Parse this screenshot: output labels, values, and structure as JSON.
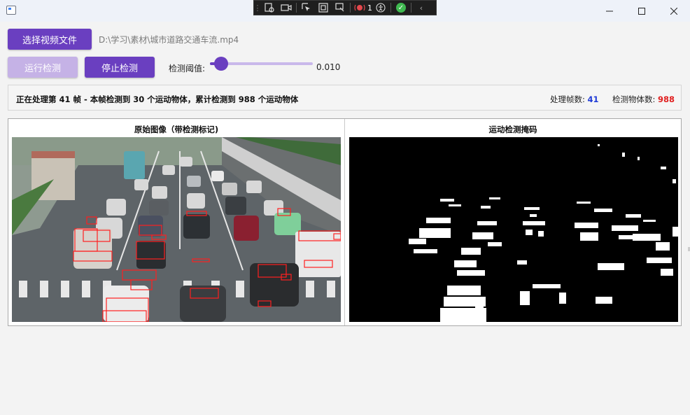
{
  "devbar": {
    "error_count": "1"
  },
  "toolbar": {
    "select_video_label": "选择视频文件",
    "file_path": "D:\\学习\\素材\\城市道路交通车流.mp4",
    "run_label": "运行检测",
    "stop_label": "停止检测",
    "threshold_label": "检测阈值:",
    "threshold_value": "0.010",
    "threshold_fraction": 0.11
  },
  "status": {
    "message": "正在处理第 41 帧 - 本帧检测到 30 个运动物体，累计检测到 988 个运动物体",
    "frames_label": "处理帧数:",
    "frames_value": "41",
    "frames_color": "#1f3bd6",
    "objects_label": "检测物体数:",
    "objects_value": "988",
    "objects_color": "#e02020"
  },
  "panels": {
    "original_title": "原始图像（带检测标记)",
    "mask_title": "运动检测掩码"
  },
  "colors": {
    "accent": "#6a3fc0",
    "accent_disabled": "#c5b2e6",
    "detection_box": "#ff2020"
  },
  "icons": [
    "window-icon",
    "inspect-icon",
    "record-icon",
    "select-element-icon",
    "layout-bounds-icon",
    "hot-reload-icon",
    "error-icon",
    "accessibility-icon",
    "check-icon",
    "chevron-left-icon",
    "minimize-icon",
    "maximize-icon",
    "close-icon"
  ]
}
